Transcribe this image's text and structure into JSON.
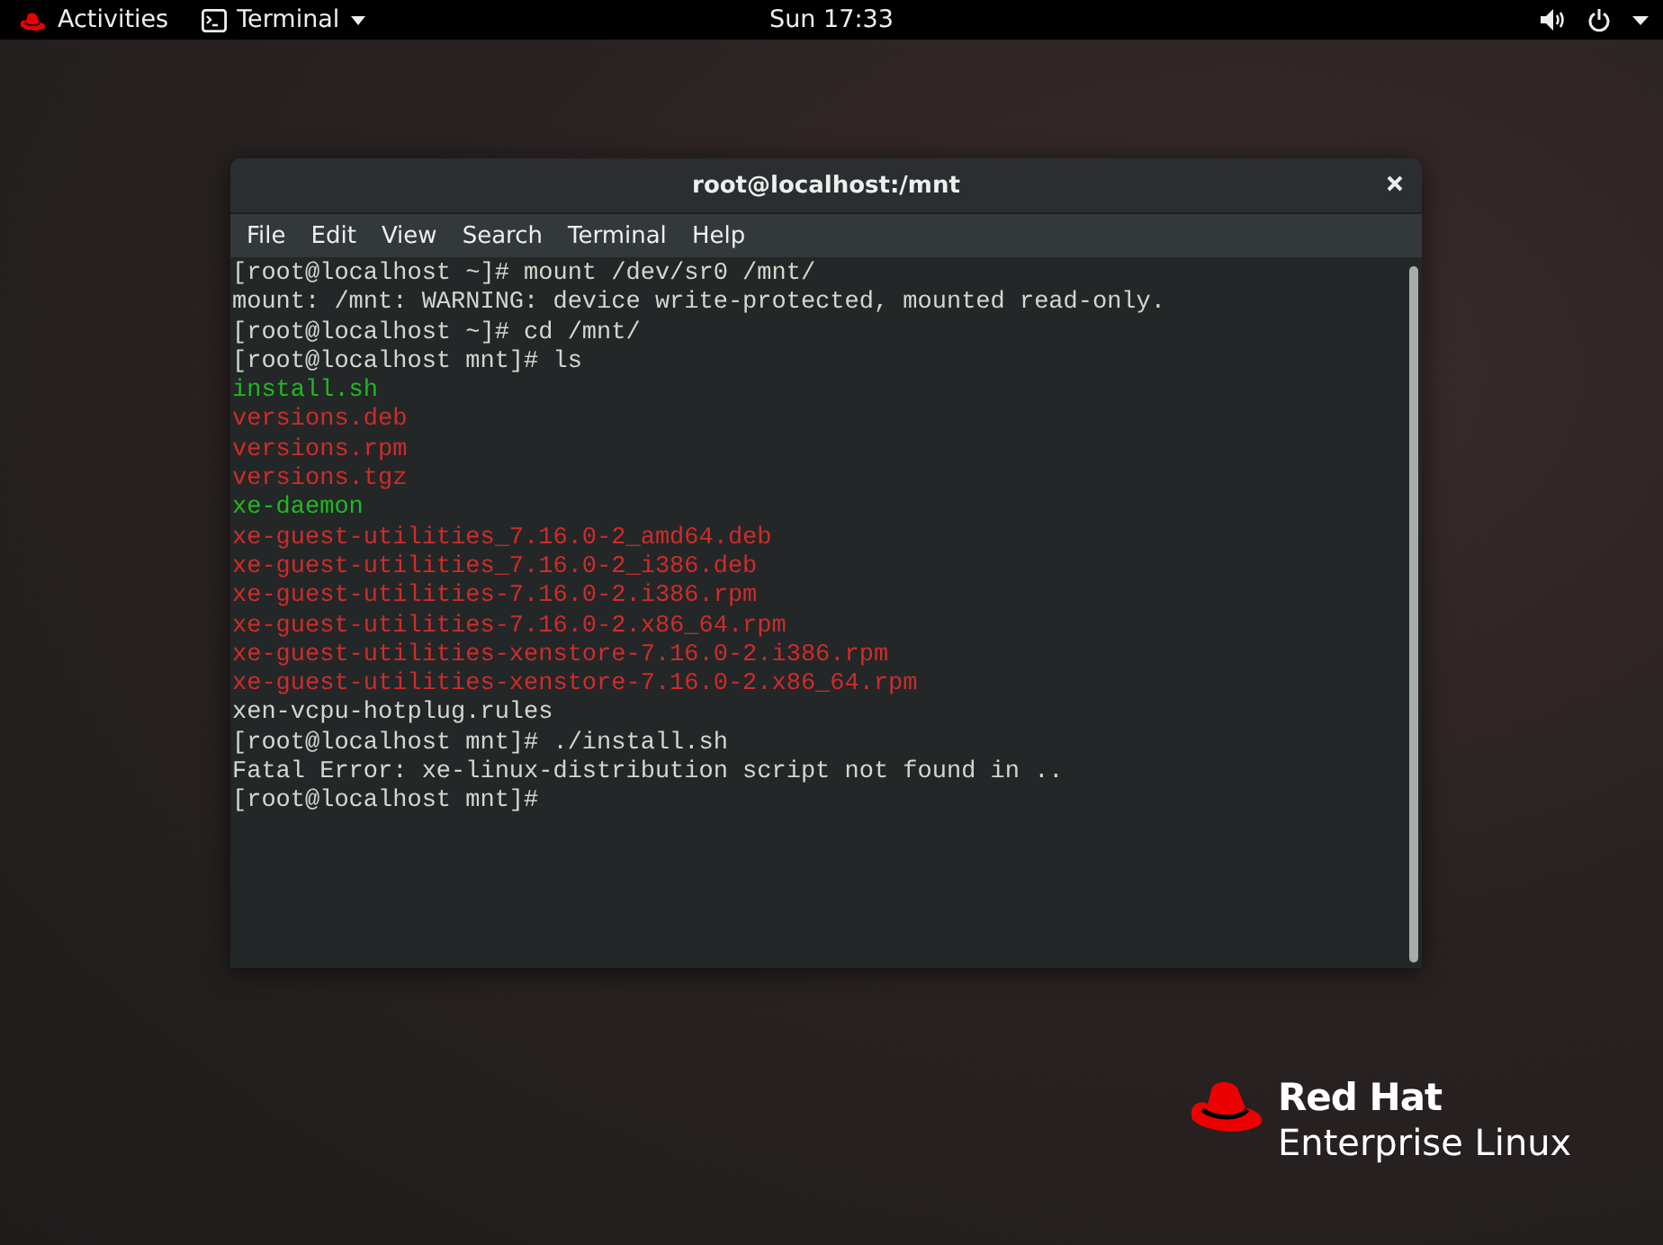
{
  "top_bar": {
    "activities": "Activities",
    "app_menu": "Terminal",
    "clock": "Sun 17:33"
  },
  "window": {
    "title": "root@localhost:/mnt",
    "menu": [
      "File",
      "Edit",
      "View",
      "Search",
      "Terminal",
      "Help"
    ],
    "lines": [
      {
        "text": "[root@localhost ~]# mount /dev/sr0 /mnt/",
        "kind": "text"
      },
      {
        "text": "mount: /mnt: WARNING: device write-protected, mounted read-only.",
        "kind": "text"
      },
      {
        "text": "[root@localhost ~]# cd /mnt/",
        "kind": "text"
      },
      {
        "text": "[root@localhost mnt]# ls",
        "kind": "text"
      },
      {
        "text": "install.sh",
        "kind": "executable"
      },
      {
        "text": "versions.deb",
        "kind": "archive"
      },
      {
        "text": "versions.rpm",
        "kind": "archive"
      },
      {
        "text": "versions.tgz",
        "kind": "archive"
      },
      {
        "text": "xe-daemon",
        "kind": "executable"
      },
      {
        "text": "xe-guest-utilities_7.16.0-2_amd64.deb",
        "kind": "archive"
      },
      {
        "text": "xe-guest-utilities_7.16.0-2_i386.deb",
        "kind": "archive"
      },
      {
        "text": "xe-guest-utilities-7.16.0-2.i386.rpm",
        "kind": "archive"
      },
      {
        "text": "xe-guest-utilities-7.16.0-2.x86_64.rpm",
        "kind": "archive"
      },
      {
        "text": "xe-guest-utilities-xenstore-7.16.0-2.i386.rpm",
        "kind": "archive"
      },
      {
        "text": "xe-guest-utilities-xenstore-7.16.0-2.x86_64.rpm",
        "kind": "archive"
      },
      {
        "text": "xen-vcpu-hotplug.rules",
        "kind": "text"
      },
      {
        "text": "[root@localhost mnt]# ./install.sh",
        "kind": "text"
      },
      {
        "text": "Fatal Error: xe-linux-distribution script not found in ..",
        "kind": "text"
      },
      {
        "text": "[root@localhost mnt]#",
        "kind": "text"
      }
    ]
  },
  "logo": {
    "brand": "Red Hat",
    "product": "Enterprise Linux"
  }
}
